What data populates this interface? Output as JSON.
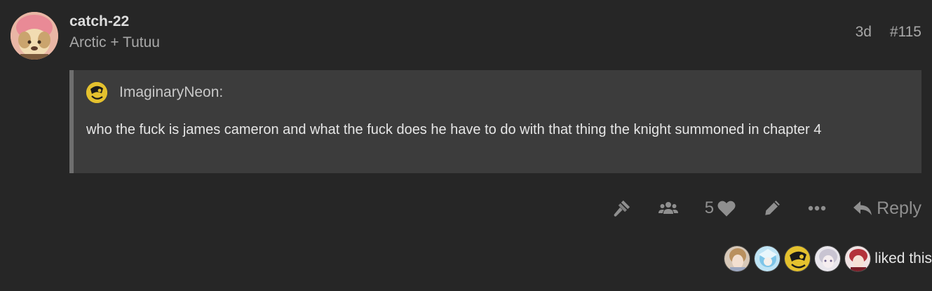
{
  "post": {
    "username": "catch-22",
    "user_title": "Arctic + Tutuu",
    "age": "3d",
    "post_number": "#115"
  },
  "quote": {
    "username": "ImaginaryNeon:",
    "text": "who the fuck is james cameron and what the fuck does he have to do with that thing the knight summoned in chapter 4"
  },
  "actions": {
    "like_count": "5",
    "reply_label": "Reply",
    "icons": [
      "gavel-icon",
      "users-icon",
      "heart-icon",
      "pencil-icon",
      "ellipsis-icon",
      "reply-icon"
    ]
  },
  "likes": {
    "text": "liked this"
  },
  "colors": {
    "background": "#262626",
    "quote_background": "#3c3c3c",
    "quote_border": "#6e6e6e",
    "muted_text": "#a8a8a8",
    "icon": "#8f8f8f"
  }
}
